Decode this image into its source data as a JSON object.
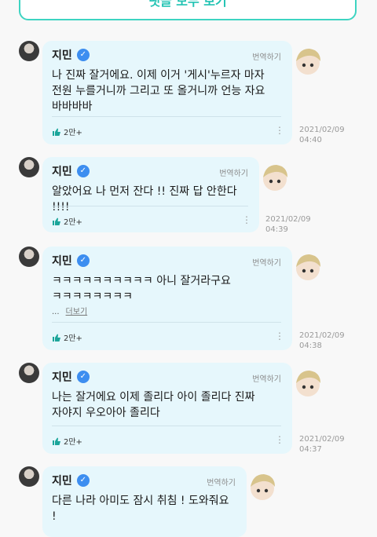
{
  "header": {
    "see_all_label": "댓글 모두 보기"
  },
  "comments": [
    {
      "author": "지민",
      "translate": "번역하기",
      "text": "나 진짜 잘거에요. 이제 이거 '게시'누르자 마자\n전원 누를거니까 그리고 또 올거니까 언능 자요\n바바바바",
      "likes": "2만+",
      "date": "2021/02/09\n04:40"
    },
    {
      "author": "지민",
      "translate": "번역하기",
      "text": "알았어요 나 먼저 잔다 !! 진짜 답 안한다 !!!!",
      "likes": "2만+",
      "date": "2021/02/09\n04:39"
    },
    {
      "author": "지민",
      "translate": "번역하기",
      "text": "ㅋㅋㅋㅋㅋㅋㅋㅋㅋㅋ 아니 잘거라구요\nㅋㅋㅋㅋㅋㅋㅋㅋ",
      "more_dots": "...",
      "more_link": "더보기",
      "likes": "2만+",
      "date": "2021/02/09\n04:38"
    },
    {
      "author": "지민",
      "translate": "번역하기",
      "text": "나는 잘거에요 이제 졸리다 아이 졸리다 진짜\n자야지 우오아아 졸리다",
      "likes": "2만+",
      "date": "2021/02/09\n04:37"
    },
    {
      "author": "지민",
      "translate": "번역하기",
      "text": "다른 나라 아미도 잠시 취침 ! 도와줘요 !"
    }
  ]
}
